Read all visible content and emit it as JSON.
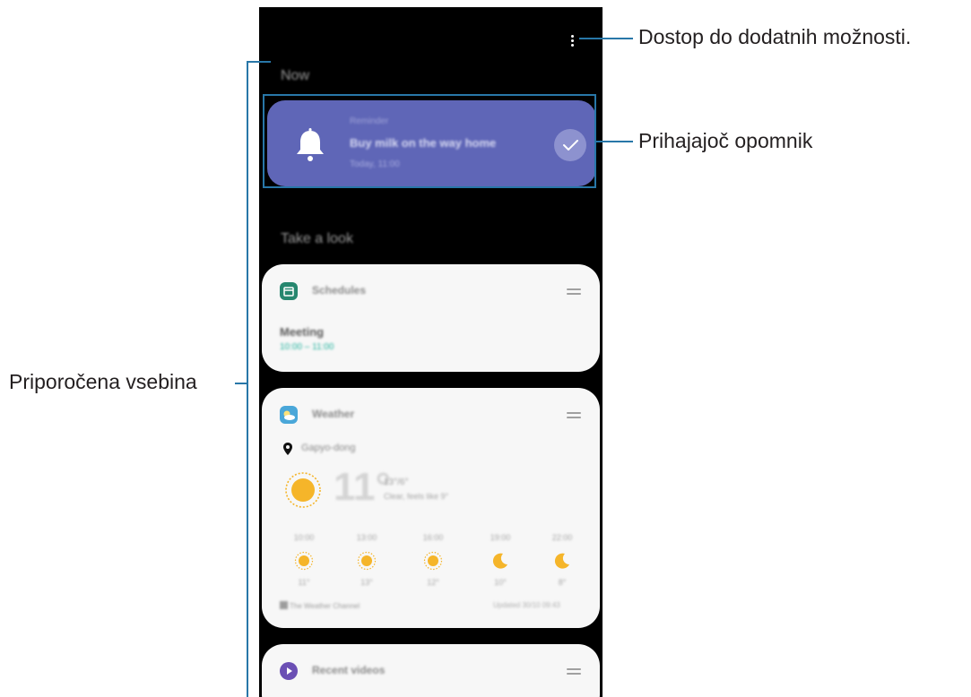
{
  "screen": {
    "section_now": "Now",
    "reminder": {
      "label": "Reminder",
      "title": "Buy milk on the way home",
      "time": "Today, 11:00"
    },
    "section_look": "Take a look",
    "schedule_card": {
      "title": "Schedules",
      "event_title": "Meeting",
      "event_time": "10:00 – 11:00"
    },
    "weather_card": {
      "title": "Weather",
      "location": "Gapyo-dong",
      "temperature": "11°",
      "temp_range": "13°/6°",
      "description": "Clear, feels like 9°",
      "hourly": [
        {
          "time": "10:00",
          "icon": "sun-icon",
          "temp": "11°"
        },
        {
          "time": "13:00",
          "icon": "sun-icon",
          "temp": "13°"
        },
        {
          "time": "16:00",
          "icon": "sun-icon",
          "temp": "12°"
        },
        {
          "time": "19:00",
          "icon": "moon-icon",
          "temp": "10°"
        },
        {
          "time": "22:00",
          "icon": "moon-icon",
          "temp": "8°"
        }
      ],
      "provider": "The Weather Channel",
      "updated": "Updated 30/10 09:43"
    },
    "videos_card": {
      "title": "Recent videos"
    }
  },
  "callouts": {
    "more_options": "Dostop do dodatnih možnosti.",
    "reminder": "Prihajajoč opomnik",
    "recommended": "Priporočena vsebina"
  },
  "colors": {
    "reminder_bg": "#5f66b7",
    "callout_line": "#2877a8",
    "schedule_icon": "#26876f",
    "weather_icon": "#4aa7d9",
    "videos_icon": "#6b4fb4",
    "sun": "#f5b52a"
  }
}
